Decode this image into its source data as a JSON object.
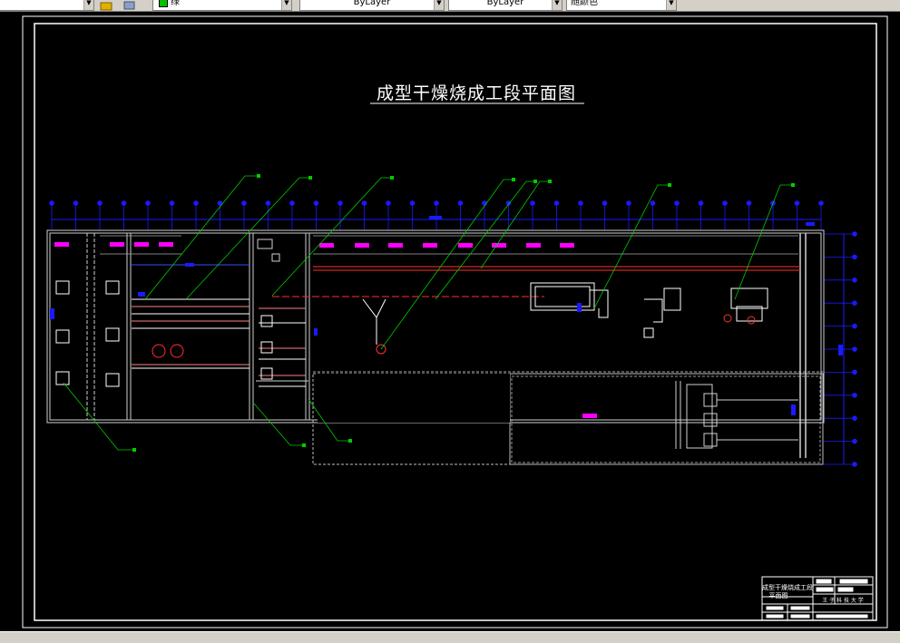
{
  "toolbar": {
    "layer_value": "绿",
    "layer_color": "#00c000",
    "color_value": "ByLayer",
    "linetype_value": "ByLayer",
    "lineweight_value": "随颜色",
    "icons": [
      "layer-state-icon",
      "layer-previous-icon",
      "layer-color-swatch-icon"
    ]
  },
  "drawing": {
    "title": "成型干燥烧成工段平面图",
    "colors": {
      "background": "#000000",
      "frame": "#ffffff",
      "grid_bubble": "#1a1aff",
      "leader": "#00cc00",
      "label_block": "#ff00ff",
      "pipe": "#ff3030"
    },
    "title_block": {
      "drawing_name_line1": "成型干燥烧成工段",
      "drawing_name_line2": "平面图",
      "school": "王 子 科 技 大 学"
    }
  }
}
